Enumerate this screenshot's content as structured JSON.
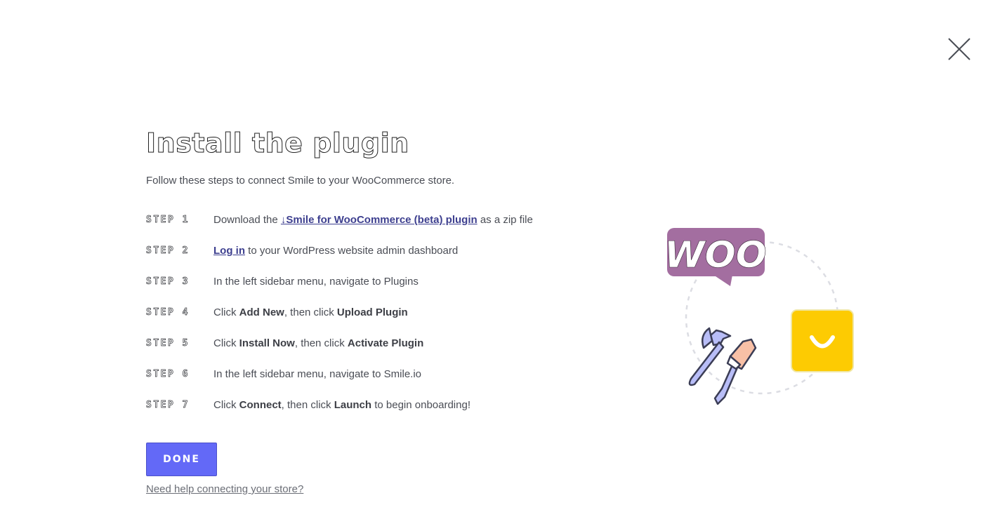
{
  "modal": {
    "title": "Install the plugin",
    "subtitle": "Follow these steps to connect Smile to your WooCommerce store."
  },
  "steps": [
    {
      "label": "STEP 1",
      "before": "Download the ",
      "link_text": "↓Smile for WooCommerce (beta) plugin",
      "after": " as a zip file"
    },
    {
      "label": "STEP 2",
      "link_text": "Log in",
      "after": " to your WordPress website admin dashboard"
    },
    {
      "label": "STEP 3",
      "text": "In the left sidebar menu, navigate to Plugins"
    },
    {
      "label": "STEP 4",
      "t1": "Click ",
      "b1": "Add New",
      "t2": ", then click ",
      "b2": "Upload Plugin"
    },
    {
      "label": "STEP 5",
      "t1": "Click ",
      "b1": "Install Now",
      "t2": ", then click ",
      "b2": "Activate Plugin"
    },
    {
      "label": "STEP 6",
      "text": "In the left sidebar menu, navigate to Smile.io"
    },
    {
      "label": "STEP 7",
      "t1": "Click ",
      "b1": "Connect",
      "t2": ", then click ",
      "b2": "Launch",
      "t3": " to begin onboarding!"
    }
  ],
  "actions": {
    "done_label": "DONE",
    "help_link": "Need help connecting your store?"
  },
  "illustration": {
    "woo_text": "WOO",
    "woo_color": "#a36ea0",
    "smile_color": "#fdcb02",
    "tool_color": "#b8bdf7",
    "handle_color": "#f8c0a6"
  },
  "icons": {
    "close": "close-icon",
    "download": "download-arrow-icon",
    "woo": "woocommerce-logo",
    "smile": "smile-logo",
    "wrench": "wrench-icon",
    "screwdriver": "screwdriver-icon"
  },
  "colors": {
    "accent": "#6369f7",
    "link": "#3d3f8f",
    "text": "#4a4d55"
  }
}
